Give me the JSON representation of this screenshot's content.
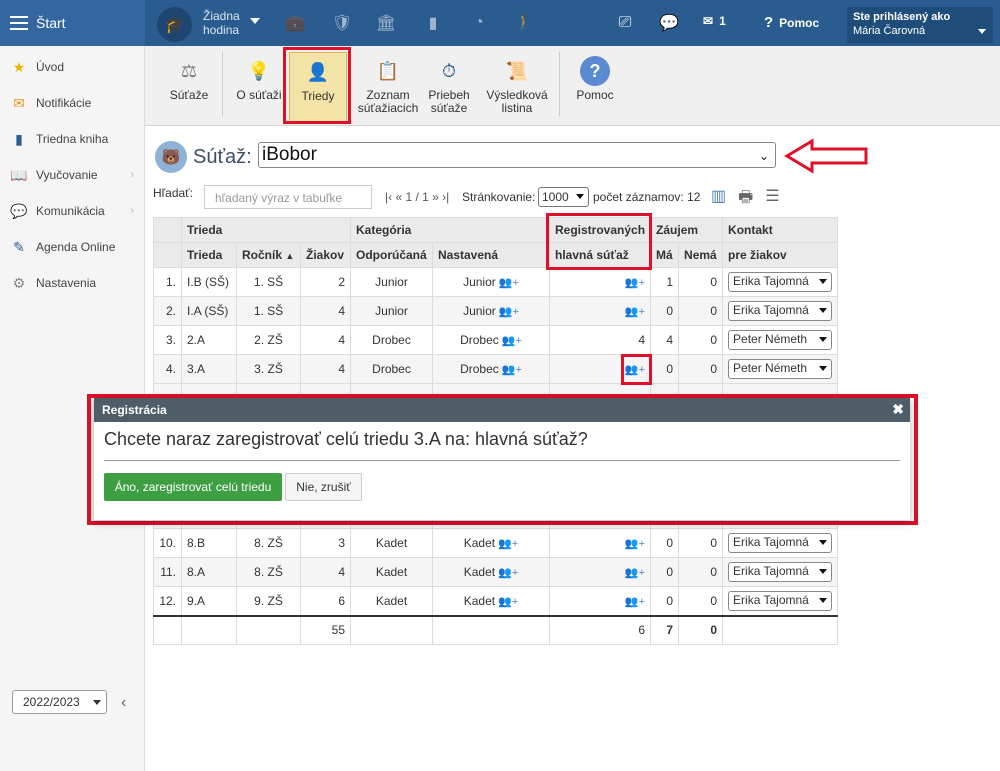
{
  "topbar": {
    "start_label": "Štart",
    "hodina_line1": "Žiadna",
    "hodina_line2": "hodina",
    "messages_count": "1",
    "help_label": "Pomoc",
    "user_label": "Ste prihlásený ako",
    "user_name": "Mária Čarovná"
  },
  "sidebar": {
    "items": [
      {
        "label": "Úvod",
        "icon": "star-icon"
      },
      {
        "label": "Notifikácie",
        "icon": "envelope-icon"
      },
      {
        "label": "Triedna kniha",
        "icon": "book-icon"
      },
      {
        "label": "Vyučovanie",
        "icon": "open-book-icon"
      },
      {
        "label": "Komunikácia",
        "icon": "chat-icon"
      },
      {
        "label": "Agenda Online",
        "icon": "pen-icon"
      },
      {
        "label": "Nastavenia",
        "icon": "gear-icon"
      }
    ],
    "year": "2022/2023"
  },
  "ribbon": {
    "sutaze": "Súťaže",
    "o_sutazi": "O súťaži",
    "triedy": "Triedy",
    "zoznam_l1": "Zoznam",
    "zoznam_l2": "súťažiacich",
    "priebeh_l1": "Priebeh",
    "priebeh_l2": "súťaže",
    "vysledkova_l1": "Výsledková",
    "vysledkova_l2": "listina",
    "pomoc": "Pomoc"
  },
  "competition": {
    "label": "Súťaž:",
    "value": "iBobor"
  },
  "toolbar": {
    "search_label": "Hľadať:",
    "search_placeholder": "hľadaný výraz v tabuľke",
    "pager": "|‹ « 1 / 1 » ›|",
    "paging_label": "Stránkovanie:",
    "paging_value": "1000",
    "count_label": "počet záznamov: 12"
  },
  "table": {
    "group_headers": {
      "trieda": "Trieda",
      "kategoria": "Kategória",
      "registrovanych": "Registrovaných",
      "zaujem": "Záujem",
      "kontakt": "Kontakt"
    },
    "headers": {
      "trieda": "Trieda",
      "rocnik": "Ročník",
      "ziakov": "Žiakov",
      "odporucana": "Odporúčaná",
      "nastavena": "Nastavená",
      "hlavna": "hlavná súťaž",
      "ma": "Má",
      "nema": "Nemá",
      "pre_ziakov": "pre žiakov"
    },
    "rows": [
      {
        "n": "1.",
        "trieda": "I.B (SŠ)",
        "rocnik": "1. SŠ",
        "ziakov": "2",
        "odporucana": "Junior",
        "nastavena": "Junior",
        "reg": "",
        "ma": "1",
        "nema": "0",
        "kontakt": "Erika Tajomná"
      },
      {
        "n": "2.",
        "trieda": "I.A (SŠ)",
        "rocnik": "1. SŠ",
        "ziakov": "4",
        "odporucana": "Junior",
        "nastavena": "Junior",
        "reg": "",
        "ma": "0",
        "nema": "0",
        "kontakt": "Erika Tajomná"
      },
      {
        "n": "3.",
        "trieda": "2.A",
        "rocnik": "2. ZŠ",
        "ziakov": "4",
        "odporucana": "Drobec",
        "nastavena": "Drobec",
        "reg": "4",
        "ma": "4",
        "nema": "0",
        "kontakt": "Peter Németh"
      },
      {
        "n": "4.",
        "trieda": "3.A",
        "rocnik": "3. ZŠ",
        "ziakov": "4",
        "odporucana": "Drobec",
        "nastavena": "Drobec",
        "reg": "",
        "ma": "0",
        "nema": "0",
        "kontakt": "Peter Németh"
      },
      {
        "n": "10.",
        "trieda": "8.B",
        "rocnik": "8. ZŠ",
        "ziakov": "3",
        "odporucana": "Kadet",
        "nastavena": "Kadet",
        "reg": "",
        "ma": "0",
        "nema": "0",
        "kontakt": "Erika Tajomná"
      },
      {
        "n": "11.",
        "trieda": "8.A",
        "rocnik": "8. ZŠ",
        "ziakov": "4",
        "odporucana": "Kadet",
        "nastavena": "Kadet",
        "reg": "",
        "ma": "0",
        "nema": "0",
        "kontakt": "Erika Tajomná"
      },
      {
        "n": "12.",
        "trieda": "9.A",
        "rocnik": "9. ZŠ",
        "ziakov": "6",
        "odporucana": "Kadet",
        "nastavena": "Kadet",
        "reg": "",
        "ma": "0",
        "nema": "0",
        "kontakt": "Erika Tajomná"
      }
    ],
    "totals": {
      "ziakov": "55",
      "reg": "6",
      "ma": "7",
      "nema": "0"
    }
  },
  "modal": {
    "title": "Registrácia",
    "question": "Chcete naraz zaregistrovať celú triedu 3.A na: hlavná súťaž?",
    "yes_label": "Áno, zaregistrovať celú triedu",
    "no_label": "Nie, zrušiť"
  },
  "colors": {
    "header_blue": "#2a5c8f",
    "highlight_red": "#e0102a",
    "yes_green": "#3e9f42"
  }
}
